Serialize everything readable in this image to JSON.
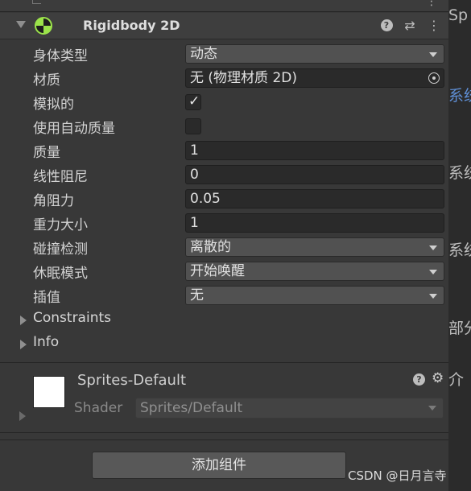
{
  "component": {
    "title": "Rigidbody 2D",
    "icon": "rigidbody2d-icon",
    "header_buttons": [
      "help-icon",
      "preset-sliders-icon",
      "kebab-menu-icon"
    ]
  },
  "properties": [
    {
      "label": "身体类型",
      "type": "dropdown",
      "value": "动态"
    },
    {
      "label": "材质",
      "type": "object",
      "value": "无 (物理材质 2D)"
    },
    {
      "label": "模拟的",
      "type": "checkbox",
      "checked": true
    },
    {
      "label": "使用自动质量",
      "type": "checkbox",
      "checked": false
    },
    {
      "label": "质量",
      "type": "number",
      "value": "1"
    },
    {
      "label": "线性阻尼",
      "type": "number",
      "value": "0"
    },
    {
      "label": "角阻力",
      "type": "number",
      "value": "0.05"
    },
    {
      "label": "重力大小",
      "type": "number",
      "value": "1"
    },
    {
      "label": "碰撞检测",
      "type": "dropdown",
      "value": "离散的"
    },
    {
      "label": "休眠模式",
      "type": "dropdown",
      "value": "开始唤醒"
    },
    {
      "label": "插值",
      "type": "dropdown",
      "value": "无"
    }
  ],
  "foldouts": [
    {
      "label": "Constraints"
    },
    {
      "label": "Info"
    }
  ],
  "material": {
    "name": "Sprites-Default",
    "swatch_color": "#ffffff",
    "shader_label": "Shader",
    "shader_value": "Sprites/Default"
  },
  "add_component_label": "添加组件",
  "side_panel_fragments": [
    "Sp",
    "系统",
    "系统",
    "系统",
    "部分",
    "介"
  ],
  "watermark": "CSDN @日月言寺",
  "colors": {
    "accent_green": "#9be34a",
    "panel_bg": "#383838",
    "field_bg": "#2a2a2a",
    "link_blue": "#5f8fd6"
  }
}
